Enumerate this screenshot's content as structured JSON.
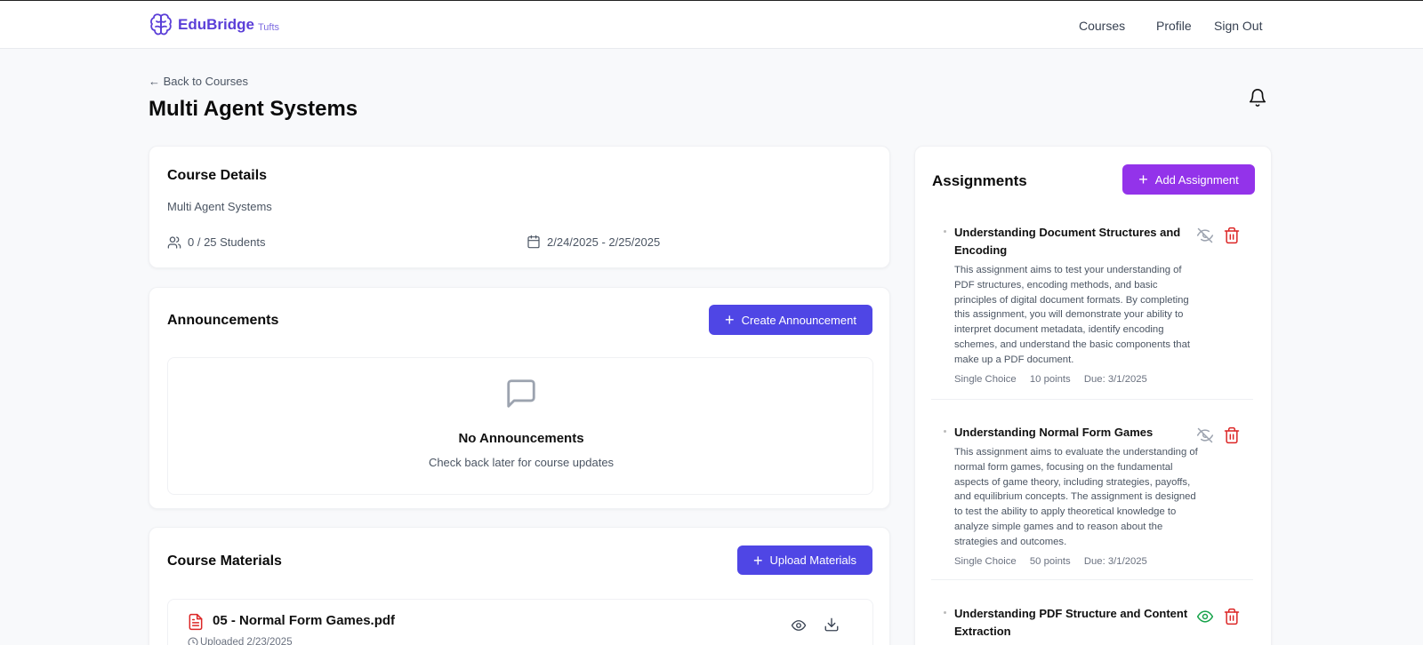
{
  "brand": {
    "name": "EduBridge",
    "sub": "Tufts"
  },
  "nav": {
    "courses": "Courses",
    "profile": "Profile",
    "sign_out": "Sign Out"
  },
  "back_link": "← Back to Courses",
  "page_title": "Multi Agent Systems",
  "course_details": {
    "heading": "Course Details",
    "description": "Multi Agent Systems",
    "students": "0 / 25 Students",
    "dates": "2/24/2025 - 2/25/2025"
  },
  "announcements": {
    "heading": "Announcements",
    "create_label": "Create Announcement",
    "empty_title": "No Announcements",
    "empty_sub": "Check back later for course updates"
  },
  "materials": {
    "heading": "Course Materials",
    "upload_label": "Upload Materials",
    "items": [
      {
        "name": "05 - Normal Form Games.pdf",
        "uploaded": "Uploaded 2/23/2025"
      }
    ]
  },
  "assignments": {
    "heading": "Assignments",
    "add_label": "Add Assignment",
    "items": [
      {
        "title": "Understanding Document Structures and Encoding",
        "description": "This assignment aims to test your understanding of PDF structures, encoding methods, and basic principles of digital document formats. By completing this assignment, you will demonstrate your ability to interpret document metadata, identify encoding schemes, and understand the basic components that make up a PDF document.",
        "type": "Single Choice",
        "points": "10 points",
        "due": "Due: 3/1/2025",
        "visible": false
      },
      {
        "title": "Understanding Normal Form Games",
        "description": "This assignment aims to evaluate the understanding of normal form games, focusing on the fundamental aspects of game theory, including strategies, payoffs, and equilibrium concepts. The assignment is designed to test the ability to apply theoretical knowledge to analyze simple games and to reason about the strategies and outcomes.",
        "type": "Single Choice",
        "points": "50 points",
        "due": "Due: 3/1/2025",
        "visible": false
      },
      {
        "title": "Understanding PDF Structure and Content Extraction",
        "visible": true
      }
    ]
  },
  "colors": {
    "primary": "#4f46e5",
    "purple": "#9333ea",
    "danger": "#dc2626",
    "success": "#16a34a",
    "brand": "#5b3fd8"
  }
}
